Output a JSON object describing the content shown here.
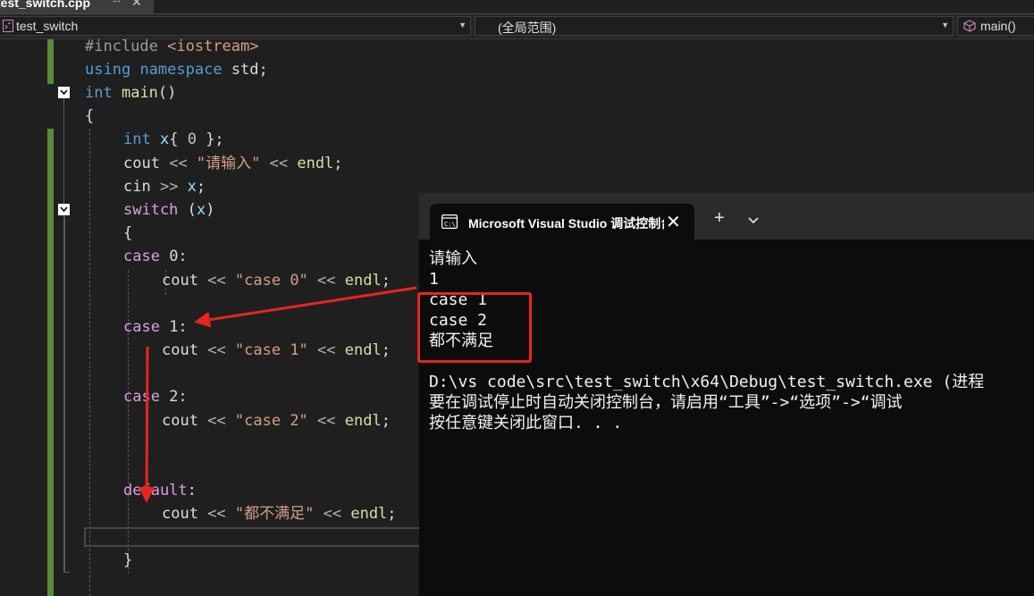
{
  "tab": {
    "filename": "test_switch.cpp",
    "pin": "ᆉ",
    "close": "✕"
  },
  "navbar": {
    "project": "test_switch",
    "scope": "(全局范围)",
    "member": "main()"
  },
  "code": {
    "line1": {
      "directive": "#include ",
      "header": "<iostream>"
    },
    "line2": {
      "kw1": "using",
      "kw2": "namespace",
      "ns": "std",
      "punct": ";"
    },
    "line3": {
      "type": "int",
      "name": "main",
      "parens": "()"
    },
    "line4": {
      "brace": "{"
    },
    "line5": {
      "type": "int",
      "var": "x",
      "rest1": "{ ",
      "num": "0",
      "rest2": " };"
    },
    "line6": {
      "id": "cout",
      "op": " << ",
      "str": "\"请输入\"",
      "op2": " << ",
      "endl": "endl",
      "semi": ";"
    },
    "line7": {
      "id": "cin",
      "op": " >> ",
      "var": "x",
      "semi": ";"
    },
    "line8": {
      "kw": "switch",
      "open": " (",
      "var": "x",
      "close": ")"
    },
    "line9": {
      "brace": "{"
    },
    "line10": {
      "kw": "case",
      "rest": " 0:"
    },
    "line11": {
      "id": "cout",
      "op": " << ",
      "str": "\"case 0\"",
      "op2": " << ",
      "endl": "endl",
      "semi": ";"
    },
    "line13": {
      "kw": "case",
      "rest": " 1:"
    },
    "line14": {
      "id": "cout",
      "op": " << ",
      "str": "\"case 1\"",
      "op2": " << ",
      "endl": "endl",
      "semi": ";"
    },
    "line16": {
      "kw": "case",
      "rest": " 2:"
    },
    "line17": {
      "id": "cout",
      "op": " << ",
      "str": "\"case 2\"",
      "op2": " << ",
      "endl": "endl",
      "semi": ";"
    },
    "line20": {
      "kw": "default",
      "rest": ":"
    },
    "line21": {
      "id": "cout",
      "op": " << ",
      "str": "\"都不满足\"",
      "op2": " << ",
      "endl": "endl",
      "semi": ";"
    },
    "line23": {
      "brace": "}"
    }
  },
  "console": {
    "title": "Microsoft Visual Studio 调试控制台",
    "close": "✕",
    "new_tab": "+",
    "lines": [
      "请输入",
      "1",
      "case 1",
      "case 2",
      "都不满足",
      "",
      "D:\\vs code\\src\\test_switch\\x64\\Debug\\test_switch.exe (进程",
      "要在调试停止时自动关闭控制台，请启用“工具”->“选项”->“调试",
      "按任意键关闭此窗口. . ."
    ]
  },
  "colors": {
    "keyword": "#569cd6",
    "control": "#d8a0df",
    "string": "#d69d85",
    "function": "#dcdcaa",
    "variable": "#9cdcfe",
    "number": "#b5cea8",
    "annotation_red": "#e8241e",
    "change_bar_green": "#57893b"
  }
}
